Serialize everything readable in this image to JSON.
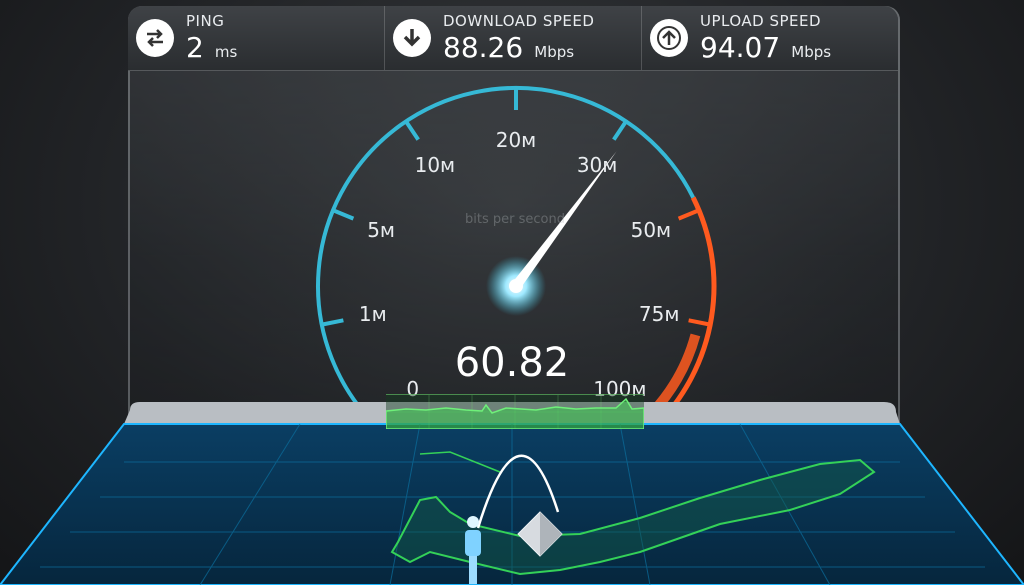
{
  "metrics": {
    "ping": {
      "label": "PING",
      "value": "2",
      "unit": "ms",
      "icon": "swap-arrows-icon"
    },
    "download": {
      "label": "DOWNLOAD SPEED",
      "value": "88.26",
      "unit": "Mbps",
      "icon": "download-arrow-icon"
    },
    "upload": {
      "label": "UPLOAD SPEED",
      "value": "94.07",
      "unit": "Mbps",
      "icon": "upload-arrow-icon"
    }
  },
  "gauge": {
    "caption": "bits per second",
    "reading": "60.82",
    "ticks": [
      "0",
      "1м",
      "5м",
      "10м",
      "20м",
      "30м",
      "50м",
      "75м",
      "100м"
    ],
    "needle_value": "30м",
    "colors": {
      "normal": "#36b9d6",
      "high": "#ff5a1f",
      "needle": "#ffffff"
    }
  },
  "graph": {
    "color": "#6ff07a"
  },
  "map": {
    "colors": {
      "grid": "#0b6f9e",
      "land": "#34d158",
      "arc": "#ffffff"
    }
  }
}
